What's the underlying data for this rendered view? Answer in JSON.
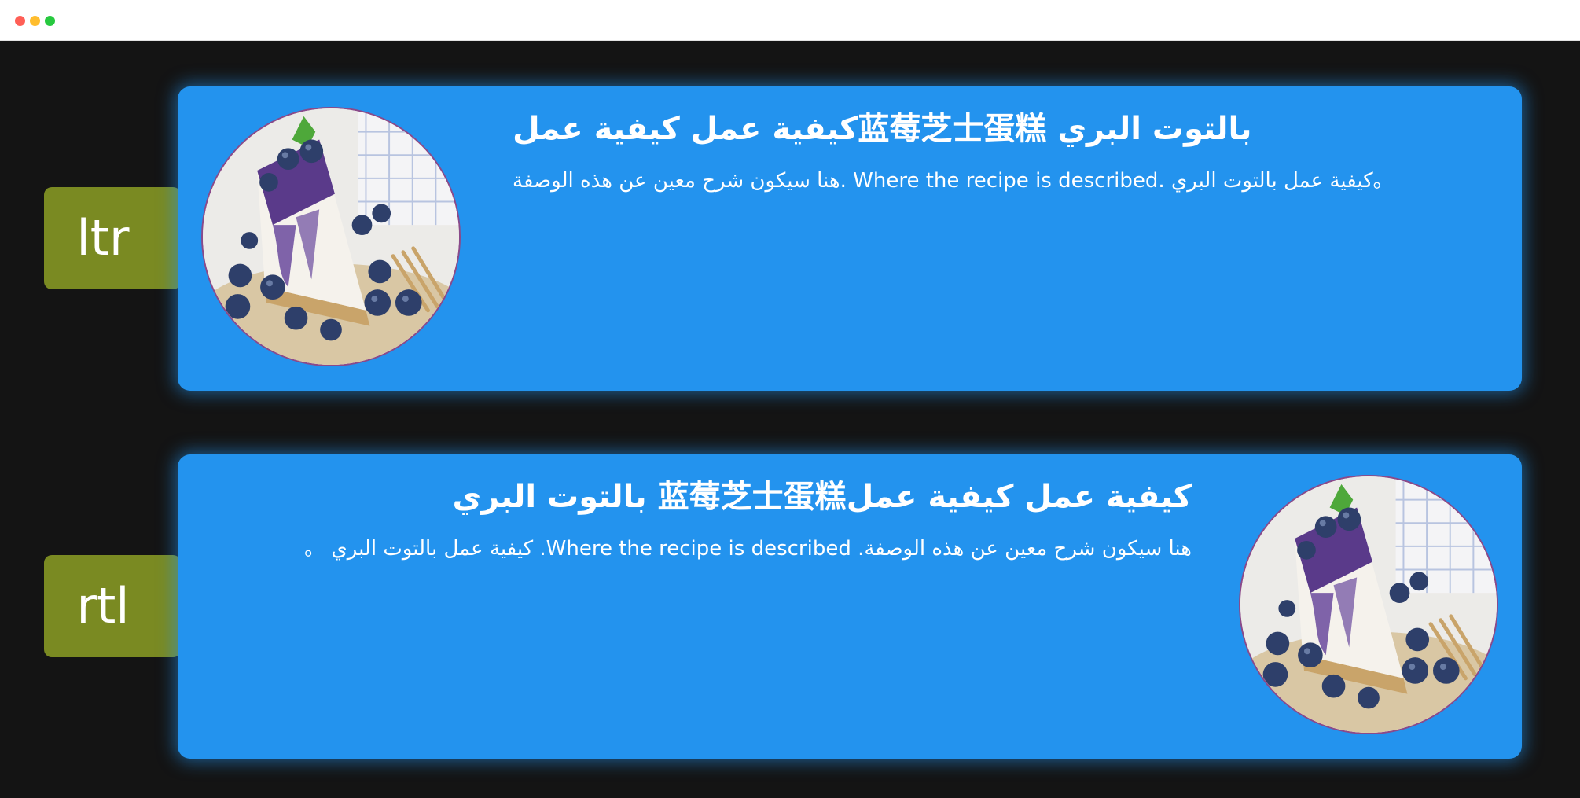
{
  "window": {
    "controls": {
      "close_color": "#ff5f56",
      "minimize_color": "#ffbd2e",
      "maximize_color": "#27c93f"
    }
  },
  "theme": {
    "background": "#141414",
    "card_color": "#2393ee",
    "tag_color": "#7a8a22"
  },
  "sections": [
    {
      "tag": "ltr",
      "direction": "ltr",
      "image_icon": "blueberry-cheesecake-photo",
      "title": "كيفية عمل كيفية عمل蓝莓芝士蛋糕 بالتوت البري",
      "description": "هنا سيكون شرح معين عن هذه الوصفة. Where the recipe is described. كيفية عمل بالتوت البري。"
    },
    {
      "tag": "rtl",
      "direction": "rtl",
      "image_icon": "blueberry-cheesecake-photo",
      "title": "كيفية عمل كيفية عمل蓝莓芝士蛋糕 بالتوت البري",
      "description": "هنا سيكون شرح معين عن هذه الوصفة. Where the recipe is described. كيفية عمل بالتوت البري 。"
    }
  ]
}
